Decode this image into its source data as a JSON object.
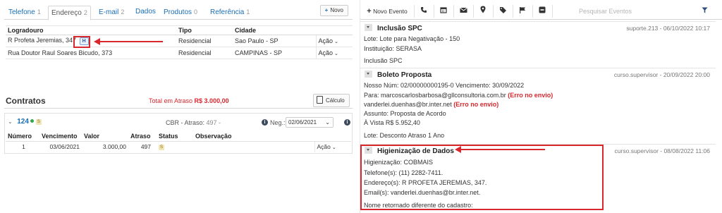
{
  "address_tabs": [
    {
      "label": "Telefone",
      "count": "1"
    },
    {
      "label": "Endereço",
      "count": "2"
    },
    {
      "label": "E-mail",
      "count": "2"
    },
    {
      "label": "Dados",
      "count": ""
    },
    {
      "label": "Produtos",
      "count": "0"
    },
    {
      "label": "Referência",
      "count": "1"
    }
  ],
  "novo_label": "Novo",
  "address_table": {
    "headers": [
      "Logradouro",
      "Tipo",
      "Cidade",
      ""
    ],
    "rows": [
      {
        "logradouro": "R Profeta Jeremias, 347",
        "badge": "H",
        "tipo": "Residencial",
        "cidade": "Sao Paulo - SP",
        "acao": "Ação"
      },
      {
        "logradouro": "Rua Doutor Raul Soares Bicudo, 373",
        "badge": "",
        "tipo": "Residencial",
        "cidade": "CAMPINAS - SP",
        "acao": "Ação"
      }
    ]
  },
  "contratos": {
    "title": "Contratos",
    "atraso_label": "Total em Atraso",
    "atraso_value": "R$ 3.000,00",
    "calc_label": "Cálculo",
    "contract": {
      "number": "124",
      "badge": "S",
      "cbr_label": "CBR - Atraso:",
      "cbr_value": "497 -",
      "neg_label": "Neg.:",
      "neg_date": "02/06/2021",
      "headers": [
        "Número",
        "Vencimento",
        "Valor",
        "Atraso",
        "Status",
        "Observação",
        ""
      ],
      "rows": [
        {
          "numero": "1",
          "vencimento": "03/06/2021",
          "valor": "3.000,00",
          "atraso": "497",
          "status": "S",
          "observacao": "",
          "acao": "Ação"
        }
      ]
    }
  },
  "events_toolbar": {
    "novo_evento": "Novo Evento",
    "search_placeholder": "Pesquisar Eventos",
    "icons": [
      "phone-icon",
      "calendar-icon",
      "envelope-icon",
      "map-marker-icon",
      "tags-icon",
      "flag-icon",
      "minus-square-icon",
      "filter-icon"
    ]
  },
  "events": [
    {
      "title": "Inclusão SPC",
      "meta": "suporte.213 - 06/10/2022 10:17",
      "lines": [
        "Lote: Lote para Negativação - 150",
        "Instituição: SERASA",
        "Inclusão SPC"
      ]
    },
    {
      "title": "Boleto Proposta",
      "meta": "curso.supervisor - 20/09/2022 20:00",
      "lines": [
        "Nosso Núm: 02/00000000195-0 Vencimento: 30/09/2022",
        "Para: marcoscarlosbarbosa@gllconsultoria.com.br",
        "vanderlei.duenhas@br.inter.net",
        "Assunto: Proposta de Acordo",
        "À Vista R$ 5.952,40",
        "Lote: Desconto Atraso 1 Ano"
      ],
      "error_label": "(Erro no envio)"
    },
    {
      "title": "Higienização de Dados",
      "meta": "curso.supervisor - 08/08/2022 11:06",
      "lines": [
        "Higienização: COBMAIS",
        "Telefone(s): (11) 2282-7411.",
        "Endereço(s): R PROFETA JEREMIAS, 347.",
        "Email(s): vanderlei.duenhas@br.inter.net.",
        "Nome retornado diferente do cadastro:"
      ]
    }
  ],
  "colors": {
    "link": "#1a6eb5",
    "alert": "#d9272e",
    "annotation": "#d9272e"
  }
}
